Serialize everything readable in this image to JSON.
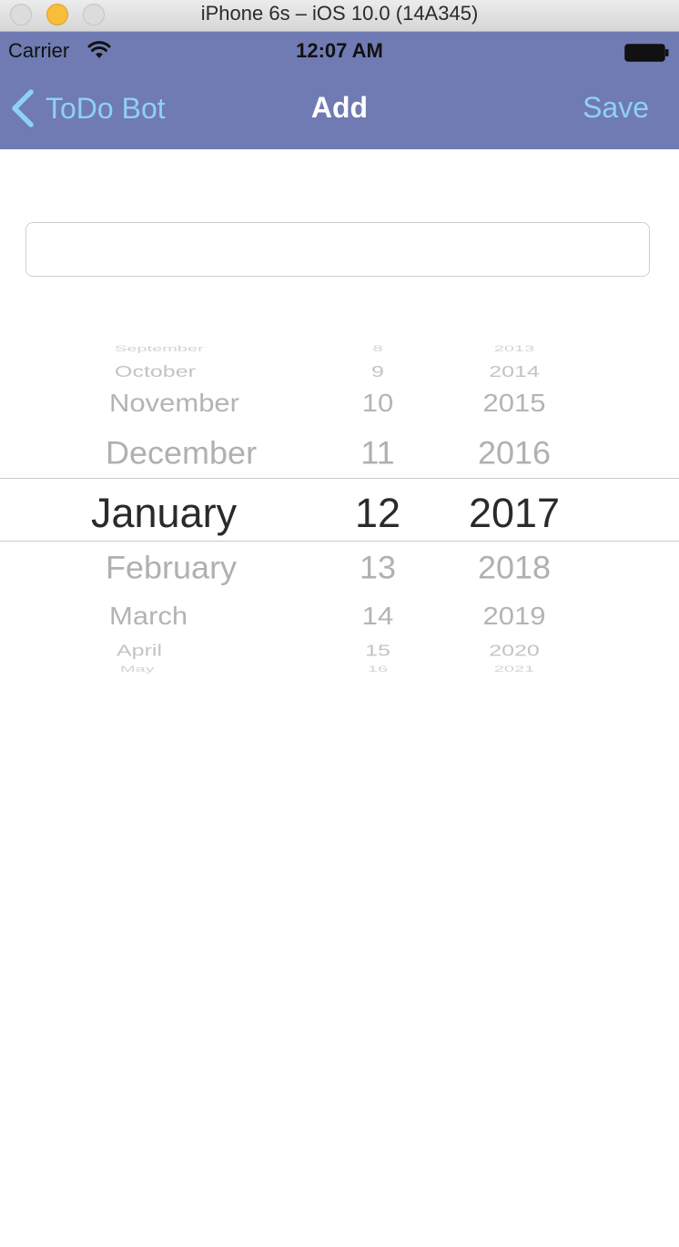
{
  "simulator": {
    "title": "iPhone 6s – iOS 10.0 (14A345)"
  },
  "status_bar": {
    "carrier": "Carrier",
    "time": "12:07 AM"
  },
  "nav_bar": {
    "back_label": "ToDo Bot",
    "title": "Add",
    "save_label": "Save"
  },
  "text_input": {
    "value": "",
    "placeholder": ""
  },
  "date_picker": {
    "months": [
      "September",
      "October",
      "November",
      "December",
      "January",
      "February",
      "March",
      "April",
      "May"
    ],
    "days": [
      "8",
      "9",
      "10",
      "11",
      "12",
      "13",
      "14",
      "15",
      "16"
    ],
    "years": [
      "2013",
      "2014",
      "2015",
      "2016",
      "2017",
      "2018",
      "2019",
      "2020",
      "2021"
    ],
    "selected": {
      "month": "January",
      "day": "12",
      "year": "2017"
    }
  },
  "colors": {
    "nav_background": "#6f7bb2",
    "nav_accent": "#8fd0f5",
    "selected_text": "#2a2a2a",
    "unselected_text": "#b0b0b0"
  }
}
